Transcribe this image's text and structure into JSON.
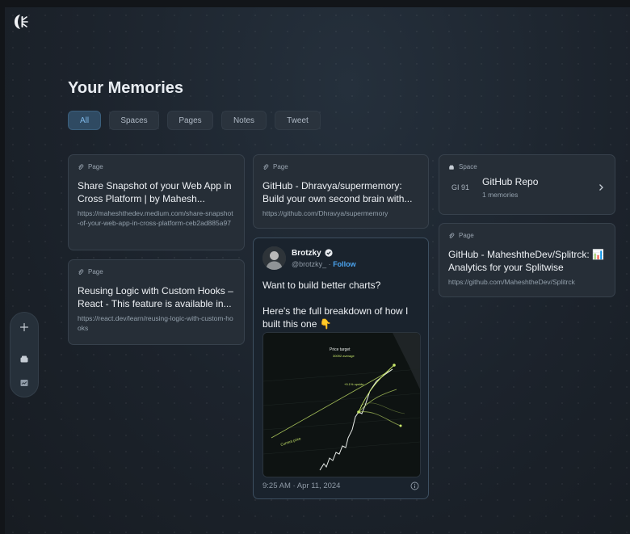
{
  "header": {
    "title": "Your Memories"
  },
  "filters": [
    "All",
    "Spaces",
    "Pages",
    "Notes",
    "Tweet"
  ],
  "cards": {
    "share": {
      "tag": "Page",
      "title": "Share Snapshot of your Web App in Cross Platform | by Mahesh...",
      "url": "https://maheshthedev.medium.com/share-snapshot-of-your-web-app-in-cross-platform-ceb2ad885a97"
    },
    "reusing": {
      "tag": "Page",
      "title": "Reusing Logic with Custom Hooks – React - This feature is available in...",
      "url": "https://react.dev/learn/reusing-logic-with-custom-hooks"
    },
    "supermemory": {
      "tag": "Page",
      "title": "GitHub - Dhravya/supermemory: Build your own second brain with...",
      "url": "https://github.com/Dhravya/supermemory"
    },
    "space": {
      "tag": "Space",
      "code": "GI 91",
      "name": "GitHub Repo",
      "count": "1 memories"
    },
    "splitrck": {
      "tag": "Page",
      "title": "GitHub - MaheshtheDev/Splitrck: 📊 Analytics for your Splitwise",
      "url": "https://github.com/MaheshtheDev/Splitrck"
    }
  },
  "tweet": {
    "name": "Brotzky",
    "handle": "@brotzky_",
    "separator": "·",
    "follow": "Follow",
    "text1": "Want to build better charts?",
    "text2": "Here's the full breakdown of how I built this one 👇",
    "timestamp": "9:25 AM · Apr 11, 2024",
    "image_labels": {
      "target": "Price target",
      "range": "30092 average",
      "pct": "+9.1% upside",
      "current": "Current price"
    }
  },
  "colors": {
    "accent": "#4ba3ee",
    "chart_line": "#c9e86a",
    "background": "#1c232b"
  }
}
